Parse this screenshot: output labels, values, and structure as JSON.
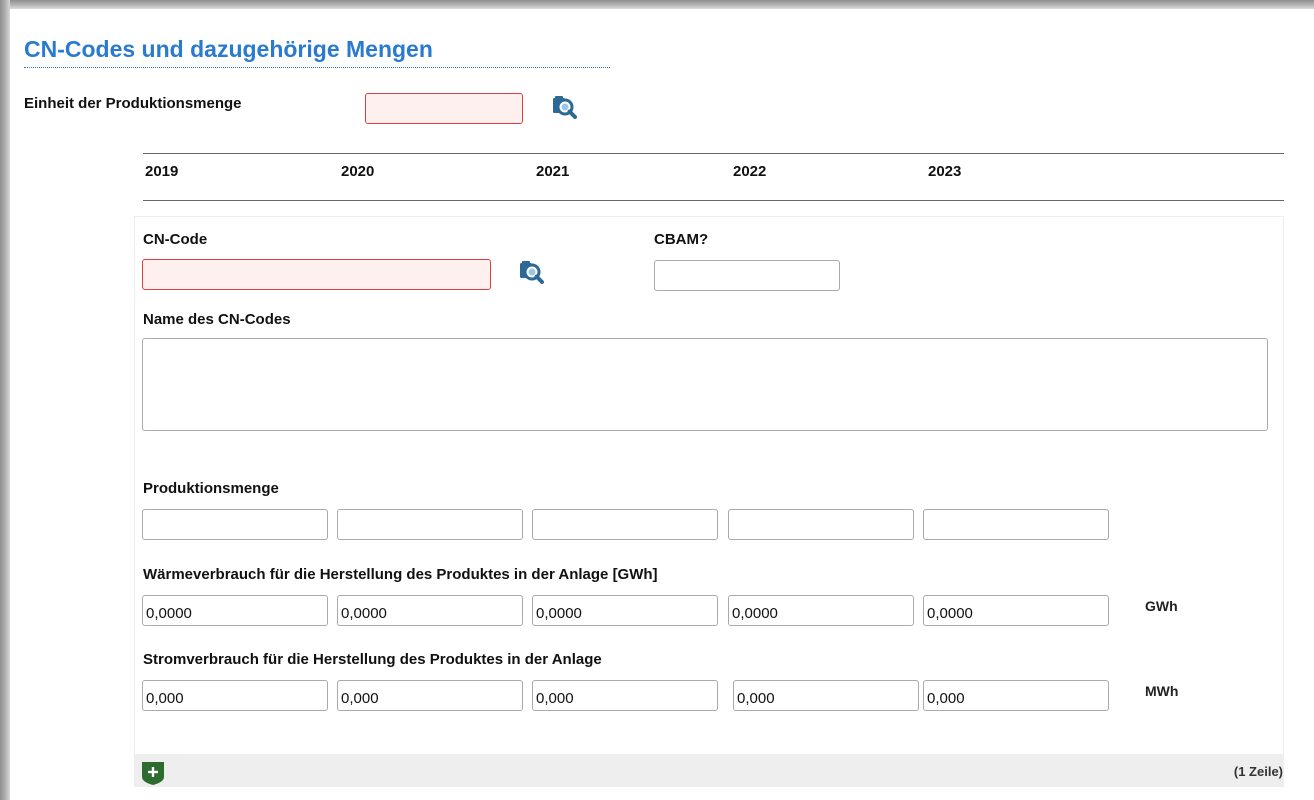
{
  "section": {
    "title": "CN-Codes und dazugehörige Mengen",
    "unit_label": "Einheit der Produktionsmenge",
    "unit_value": ""
  },
  "years": [
    "2019",
    "2020",
    "2021",
    "2022",
    "2023"
  ],
  "row": {
    "cn_code_label": "CN-Code",
    "cn_code_value": "",
    "cbam_label": "CBAM?",
    "cbam_value": "",
    "cn_name_label": "Name des CN-Codes",
    "cn_name_value": "",
    "production": {
      "label": "Produktionsmenge",
      "values": [
        "",
        "",
        "",
        "",
        ""
      ]
    },
    "heat": {
      "label": "Wärmeverbrauch für die Herstellung des Produktes in der Anlage [GWh]",
      "values": [
        "0,0000",
        "0,0000",
        "0,0000",
        "0,0000",
        "0,0000"
      ],
      "unit": "GWh"
    },
    "power": {
      "label": "Stromverbrauch für die Herstellung des Produktes in der Anlage",
      "values": [
        "0,000",
        "0,000",
        "0,000",
        "0,000",
        "0,000"
      ],
      "unit": "MWh"
    }
  },
  "footer": {
    "add_icon": "plus-icon",
    "row_count": "(1 Zeile)"
  },
  "icons": {
    "lookup": "magnifier-lookup-icon"
  },
  "colors": {
    "title": "#2a7bd0",
    "required_border": "#e04040",
    "required_bg": "#fff0f0",
    "lookup_icon": "#2c6a95",
    "add_button": "#2e6b2e"
  }
}
